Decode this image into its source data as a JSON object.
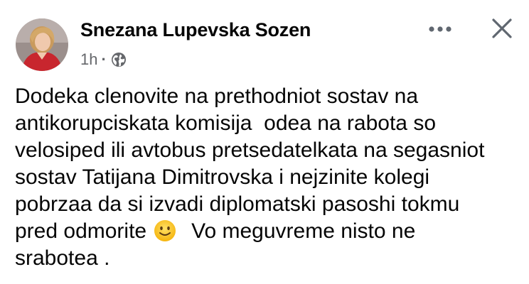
{
  "post": {
    "author": "Snezana Lupevska Sozen",
    "time": "1h",
    "separator": "·",
    "audience_icon": "globe-icon",
    "more_icon": "more-options-icon",
    "close_icon": "close-icon",
    "body_lines": [
      "Dodeka clenovite na prethodniot sostav na",
      "antikorupciskata komisija  odea na rabota so",
      "velosiped ili avtobus pretsedatelkata na segasniot",
      "sostav Tatijana Dimitrovska i nejzinite kolegi",
      "pobrzaa da si izvadi diplomatski pasoshi tokmu"
    ],
    "line6_before_emoji": "pred odmorite ",
    "emoji": "slightly-smiling-face-emoji",
    "line6_after_emoji": "  Vo meguvreme nisto ne",
    "line7": "srabotea ."
  },
  "colors": {
    "text": "#050505",
    "secondary_text": "#65676b",
    "icon": "#606770",
    "emoji_face": "#f7c21d",
    "avatar_dress": "#c8262e"
  }
}
